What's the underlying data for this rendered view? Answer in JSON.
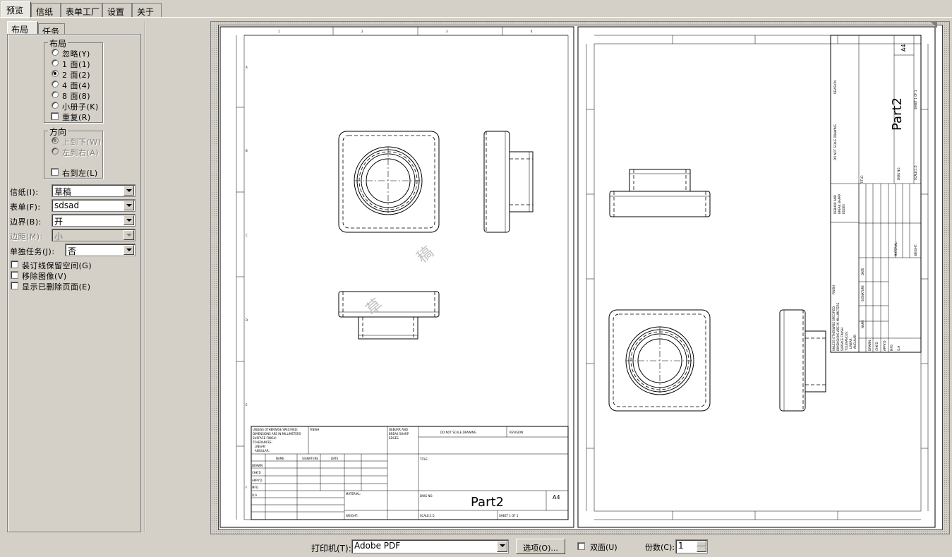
{
  "tabs": [
    "预览",
    "信纸",
    "表单工厂",
    "设置",
    "关于"
  ],
  "subtabs": [
    "布局",
    "任务"
  ],
  "layout_group": {
    "title": "布局",
    "options": [
      "忽略(Y)",
      "1 面(1)",
      "2 面(2)",
      "4 面(4)",
      "8 面(8)",
      "小册子(K)"
    ],
    "selected": "2 面(2)",
    "repeat": "重复(R)"
  },
  "direction_group": {
    "title": "方向",
    "options": [
      "上到下(W)",
      "左到右(A)"
    ],
    "rtl": "右到左(L)"
  },
  "fields": {
    "paper": {
      "label": "信纸(I):",
      "value": "草稿"
    },
    "form": {
      "label": "表单(F):",
      "value": "sdsad"
    },
    "border": {
      "label": "边界(B):",
      "value": "开"
    },
    "margin": {
      "label": "边距(M):",
      "value": "小"
    },
    "single_job": {
      "label": "单独任务(J):",
      "value": "否"
    }
  },
  "checks": [
    "装订线保留空间(G)",
    "移除图像(V)",
    "显示已删除页面(E)"
  ],
  "watermark": [
    "草",
    "稿"
  ],
  "drawing": {
    "part": "Part2",
    "size": "A4",
    "col_labels": [
      "1",
      "2",
      "3",
      "4"
    ],
    "row_labels": [
      "A",
      "B",
      "C",
      "D",
      "E",
      "F"
    ],
    "tb_notes": [
      "UNLESS OTHERWISE SPECIFIED:",
      "DIMENSIONS ARE IN MILLIMETERS",
      "SURFACE FINISH:",
      "TOLERANCES:",
      "LINEAR:",
      "ANGULAR:"
    ],
    "tb_finish": "FINISH",
    "tb_deburr": [
      "DEBURR AND",
      "BREAK SHARP",
      "EDGES"
    ],
    "tb_noscale": "DO NOT SCALE DRAWING",
    "tb_revision": "REVISION",
    "tb_title": "TITLE:",
    "tb_heads": [
      "NAME",
      "SIGNATURE",
      "DATE"
    ],
    "tb_rows": [
      "DRAWN",
      "CHK'D",
      "APPV'D",
      "MFG",
      "Q.A"
    ],
    "tb_material": "MATERIAL:",
    "tb_dwgno": "DWG NO.",
    "tb_weight": "WEIGHT:",
    "tb_scale": "SCALE:1:5",
    "tb_sheet": "SHEET 1 OF 1"
  },
  "printer": {
    "label": "打印机(T):",
    "value": "Adobe PDF",
    "options_button": "选项(O)...",
    "duplex": "双面(U)",
    "copies_label": "份数(C):",
    "copies": "1"
  }
}
